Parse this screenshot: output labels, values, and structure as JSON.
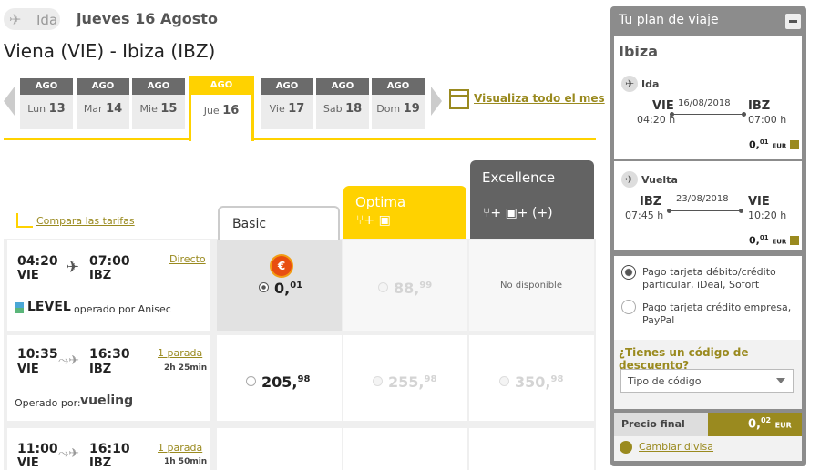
{
  "header": {
    "ida_label": "Ida",
    "date": "jueves 16 Agosto",
    "route": "Viena (VIE) - Ibiza (IBZ)"
  },
  "dates": [
    {
      "month": "AGO",
      "day_name": "Lun",
      "day": "13",
      "selected": false
    },
    {
      "month": "AGO",
      "day_name": "Mar",
      "day": "14",
      "selected": false
    },
    {
      "month": "AGO",
      "day_name": "Mie",
      "day": "15",
      "selected": false
    },
    {
      "month": "AGO",
      "day_name": "Jue",
      "day": "16",
      "selected": true
    },
    {
      "month": "AGO",
      "day_name": "Vie",
      "day": "17",
      "selected": false
    },
    {
      "month": "AGO",
      "day_name": "Sab",
      "day": "18",
      "selected": false
    },
    {
      "month": "AGO",
      "day_name": "Dom",
      "day": "19",
      "selected": false
    }
  ],
  "view_month_label": "Visualiza todo el mes",
  "compare_label": "Compara las tarifas",
  "fares": {
    "basic": "Basic",
    "optima": "Optima",
    "optima_icons": "⑂+ ▣",
    "excellence": "Excellence",
    "excellence_icons": "⑂+ ▣+ (+)"
  },
  "flights": [
    {
      "dep_time": "04:20",
      "dep_code": "VIE",
      "arr_time": "07:00",
      "arr_code": "IBZ",
      "type": "Directo",
      "duration": "",
      "airline": "LEVEL",
      "operator": "operado por Anisec",
      "basic_int": "0,",
      "basic_dec": "01",
      "optima_int": "88,",
      "optima_dec": "99",
      "excellence_text": "No disponible"
    },
    {
      "dep_time": "10:35",
      "dep_code": "VIE",
      "arr_time": "16:30",
      "arr_code": "IBZ",
      "type": "1 parada",
      "duration": "2h 25min",
      "operator": "Operado por:",
      "airline": "vueling",
      "basic_int": "205,",
      "basic_dec": "98",
      "optima_int": "255,",
      "optima_dec": "98",
      "excellence_int": "350,",
      "excellence_dec": "98"
    },
    {
      "dep_time": "11:00",
      "dep_code": "VIE",
      "arr_time": "16:10",
      "arr_code": "IBZ",
      "type": "1 parada",
      "duration": "1h 50min"
    }
  ],
  "plan": {
    "title": "Tu plan de viaje",
    "destination": "Ibiza",
    "outbound": {
      "label": "Ida",
      "from": "VIE",
      "from_time": "04:20 h",
      "date": "16/08/2018",
      "to": "IBZ",
      "to_time": "07:00 h",
      "price_int": "0,",
      "price_dec": "01",
      "currency": "EUR"
    },
    "return": {
      "label": "Vuelta",
      "from": "IBZ",
      "from_time": "07:45 h",
      "date": "23/08/2018",
      "to": "VIE",
      "to_time": "10:20 h",
      "price_int": "0,",
      "price_dec": "01",
      "currency": "EUR"
    },
    "payment_1": "Pago tarjeta débito/crédito particular, iDeal, Sofort",
    "payment_2": "Pago tarjeta crédito empresa, PayPal",
    "discount_q": "¿Tienes un código de descuento?",
    "code_type": "Tipo de código",
    "final_label": "Precio final",
    "final_int": "0,",
    "final_dec": "02",
    "final_currency": "EUR",
    "currency_link": "Cambiar divisa"
  },
  "colors": {
    "accent": "#ffd200",
    "link": "#9a8a1f",
    "dark": "#636363"
  }
}
